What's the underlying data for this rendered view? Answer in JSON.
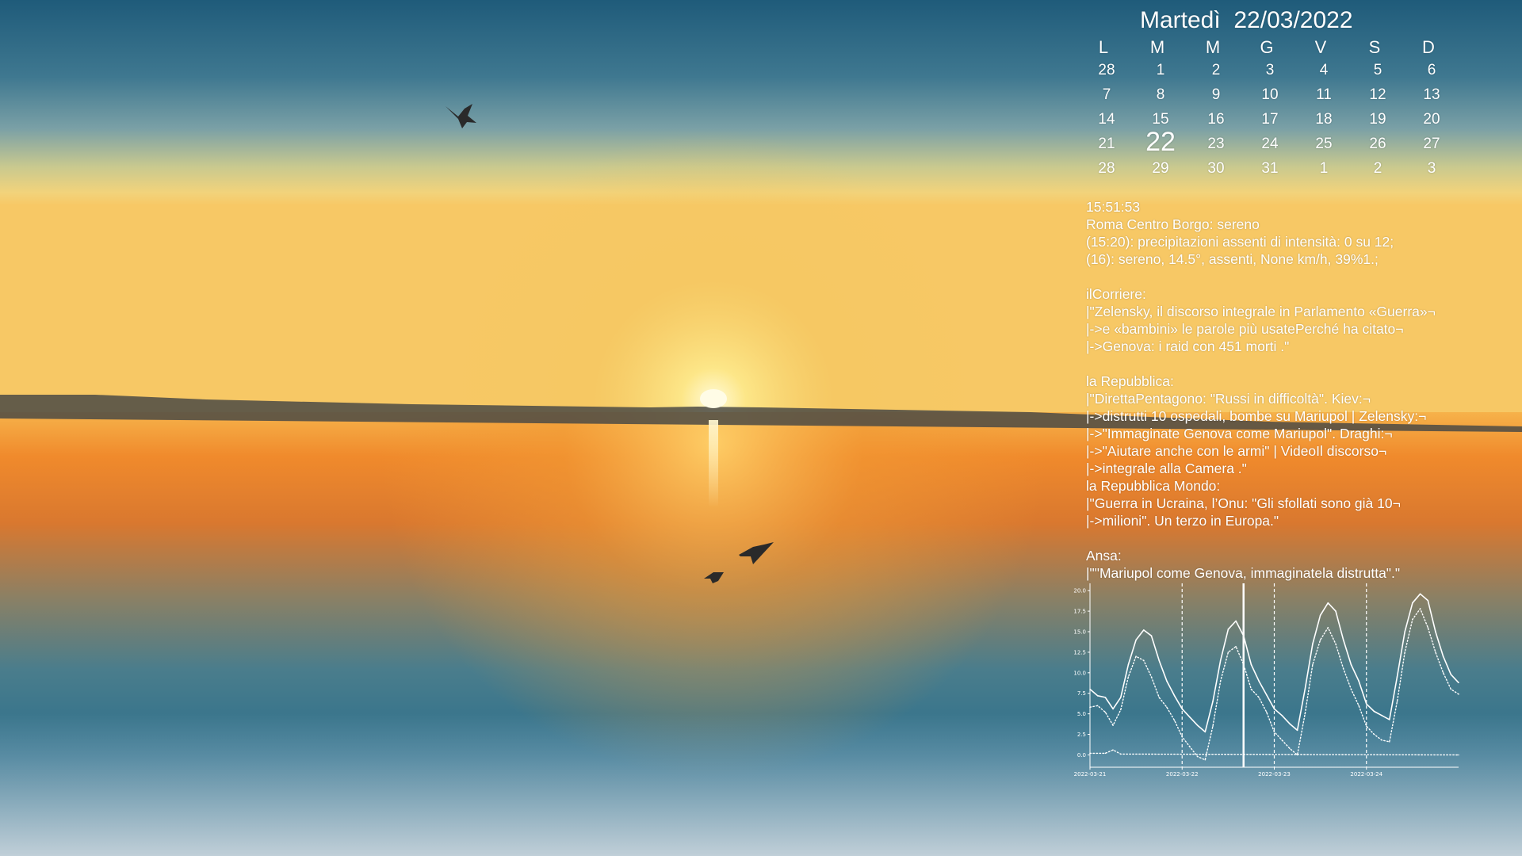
{
  "calendar": {
    "title": "Martedì  22/03/2022",
    "weekdays": [
      "L",
      "M",
      "M",
      "G",
      "V",
      "S",
      "D"
    ],
    "weeks": [
      [
        "28",
        "1",
        "2",
        "3",
        "4",
        "5",
        "6"
      ],
      [
        "7",
        "8",
        "9",
        "10",
        "11",
        "12",
        "13"
      ],
      [
        "14",
        "15",
        "16",
        "17",
        "18",
        "19",
        "20"
      ],
      [
        "21",
        "22",
        "23",
        "24",
        "25",
        "26",
        "27"
      ],
      [
        "28",
        "29",
        "30",
        "31",
        "1",
        "2",
        "3"
      ]
    ],
    "today": "22"
  },
  "info_lines": [
    "15:51:53",
    "Roma Centro Borgo: sereno",
    "(15:20): precipitazioni assenti di intensità: 0 su 12;",
    "(16): sereno, 14.5°, assenti, None km/h, 39%1.;",
    "",
    "ilCorriere:",
    "|\"Zelensky, il discorso integrale in Parlamento «Guerra»¬",
    "|->e «bambini» le parole più usatePerché ha citato¬",
    "|->Genova: i raid con 451 morti .\"",
    "",
    "la Repubblica:",
    "|\"DirettaPentagono: \"Russi in difficoltà\". Kiev:¬",
    "|->distrutti 10 ospedali, bombe su Mariupol | Zelensky:¬",
    "|->\"Immaginate Genova come Mariupol\". Draghi:¬",
    "|->\"Aiutare anche con le armi\" | VideoIl discorso¬",
    "|->integrale alla Camera .\"",
    "la Repubblica Mondo:",
    "|\"Guerra in Ucraina, l’Onu: \"Gli sfollati sono già 10¬",
    "|->milioni\". Un terzo in Europa.\"",
    "",
    "Ansa:",
    "|\"\"Mariupol come Genova, immaginatela distrutta\".\""
  ],
  "chart_data": {
    "type": "line",
    "x_tick_labels": [
      "2022-03-21",
      "2022-03-22",
      "2022-03-23",
      "2022-03-24"
    ],
    "y_ticks": [
      0.0,
      2.5,
      5.0,
      7.5,
      10.0,
      12.5,
      15.0,
      17.5,
      20.0
    ],
    "xlim": [
      "2022-03-21",
      "2022-03-25"
    ],
    "ylim": [
      -1.5,
      20.5
    ],
    "day_separator_dates": [
      "2022-03-22",
      "2022-03-23",
      "2022-03-24"
    ],
    "now_marker": "2022-03-22T16:00",
    "series": [
      {
        "style": "solid",
        "x": [
          "2022-03-21T00:00",
          "2022-03-21T02:00",
          "2022-03-21T04:00",
          "2022-03-21T06:00",
          "2022-03-21T08:00",
          "2022-03-21T10:00",
          "2022-03-21T12:00",
          "2022-03-21T14:00",
          "2022-03-21T16:00",
          "2022-03-21T18:00",
          "2022-03-21T20:00",
          "2022-03-21T22:00",
          "2022-03-22T00:00",
          "2022-03-22T02:00",
          "2022-03-22T04:00",
          "2022-03-22T06:00",
          "2022-03-22T08:00",
          "2022-03-22T10:00",
          "2022-03-22T12:00",
          "2022-03-22T14:00",
          "2022-03-22T16:00",
          "2022-03-22T18:00",
          "2022-03-22T20:00",
          "2022-03-22T22:00",
          "2022-03-23T00:00",
          "2022-03-23T02:00",
          "2022-03-23T04:00",
          "2022-03-23T06:00",
          "2022-03-23T08:00",
          "2022-03-23T10:00",
          "2022-03-23T12:00",
          "2022-03-23T14:00",
          "2022-03-23T16:00",
          "2022-03-23T18:00",
          "2022-03-23T20:00",
          "2022-03-23T22:00",
          "2022-03-24T00:00",
          "2022-03-24T02:00",
          "2022-03-24T04:00",
          "2022-03-24T06:00",
          "2022-03-24T08:00",
          "2022-03-24T10:00",
          "2022-03-24T12:00",
          "2022-03-24T14:00",
          "2022-03-24T16:00",
          "2022-03-24T18:00",
          "2022-03-24T20:00",
          "2022-03-24T22:00",
          "2022-03-25T00:00"
        ],
        "values": [
          8.0,
          7.2,
          7.0,
          5.6,
          7.0,
          11.0,
          14.0,
          15.2,
          14.5,
          11.5,
          9.0,
          7.2,
          5.6,
          4.6,
          3.6,
          2.8,
          6.5,
          11.5,
          15.3,
          16.3,
          14.5,
          11.0,
          9.0,
          7.3,
          5.6,
          4.8,
          3.8,
          3.0,
          8.0,
          13.5,
          17.0,
          18.5,
          17.5,
          14.0,
          11.0,
          9.0,
          6.2,
          5.3,
          4.8,
          4.3,
          9.5,
          15.0,
          18.5,
          19.6,
          18.8,
          15.0,
          12.0,
          9.8,
          8.8
        ]
      },
      {
        "style": "dotted",
        "x": [
          "2022-03-21T00:00",
          "2022-03-21T02:00",
          "2022-03-21T04:00",
          "2022-03-21T06:00",
          "2022-03-21T08:00",
          "2022-03-21T10:00",
          "2022-03-21T12:00",
          "2022-03-21T14:00",
          "2022-03-21T16:00",
          "2022-03-21T18:00",
          "2022-03-21T20:00",
          "2022-03-21T22:00",
          "2022-03-22T00:00",
          "2022-03-22T02:00",
          "2022-03-22T04:00",
          "2022-03-22T06:00",
          "2022-03-22T08:00",
          "2022-03-22T10:00",
          "2022-03-22T12:00",
          "2022-03-22T14:00",
          "2022-03-22T16:00",
          "2022-03-22T18:00",
          "2022-03-22T20:00",
          "2022-03-22T22:00",
          "2022-03-23T00:00",
          "2022-03-23T02:00",
          "2022-03-23T04:00",
          "2022-03-23T06:00",
          "2022-03-23T08:00",
          "2022-03-23T10:00",
          "2022-03-23T12:00",
          "2022-03-23T14:00",
          "2022-03-23T16:00",
          "2022-03-23T18:00",
          "2022-03-23T20:00",
          "2022-03-23T22:00",
          "2022-03-24T00:00",
          "2022-03-24T02:00",
          "2022-03-24T04:00",
          "2022-03-24T06:00",
          "2022-03-24T08:00",
          "2022-03-24T10:00",
          "2022-03-24T12:00",
          "2022-03-24T14:00",
          "2022-03-24T16:00",
          "2022-03-24T18:00",
          "2022-03-24T20:00",
          "2022-03-24T22:00",
          "2022-03-25T00:00"
        ],
        "values": [
          5.8,
          6.0,
          5.2,
          3.6,
          5.5,
          9.5,
          12.0,
          11.5,
          9.5,
          7.0,
          5.8,
          4.2,
          2.2,
          1.0,
          -0.2,
          -0.6,
          3.5,
          9.0,
          12.5,
          13.2,
          11.0,
          8.0,
          7.0,
          5.2,
          2.8,
          1.8,
          0.8,
          0.0,
          5.0,
          11.0,
          14.0,
          15.5,
          13.5,
          10.5,
          8.0,
          6.0,
          3.5,
          2.5,
          1.8,
          1.6,
          6.5,
          12.5,
          16.5,
          17.8,
          15.5,
          12.5,
          10.0,
          8.0,
          7.4
        ]
      },
      {
        "style": "dotted",
        "x": [
          "2022-03-21T00:00",
          "2022-03-21T04:00",
          "2022-03-21T06:00",
          "2022-03-21T08:00",
          "2022-03-25T00:00"
        ],
        "values": [
          0.2,
          0.2,
          0.6,
          0.1,
          0.0
        ]
      }
    ]
  },
  "colors": {
    "sky_top": "#1f5b7a",
    "sky_mid": "#6f9aa6",
    "horizon_glow": "#f6d479",
    "sun": "#fff2b8",
    "water_orange": "#f2932e",
    "water_deep": "#2c6f8c",
    "mist": "#c8d4dc",
    "text": "#ffffff"
  }
}
